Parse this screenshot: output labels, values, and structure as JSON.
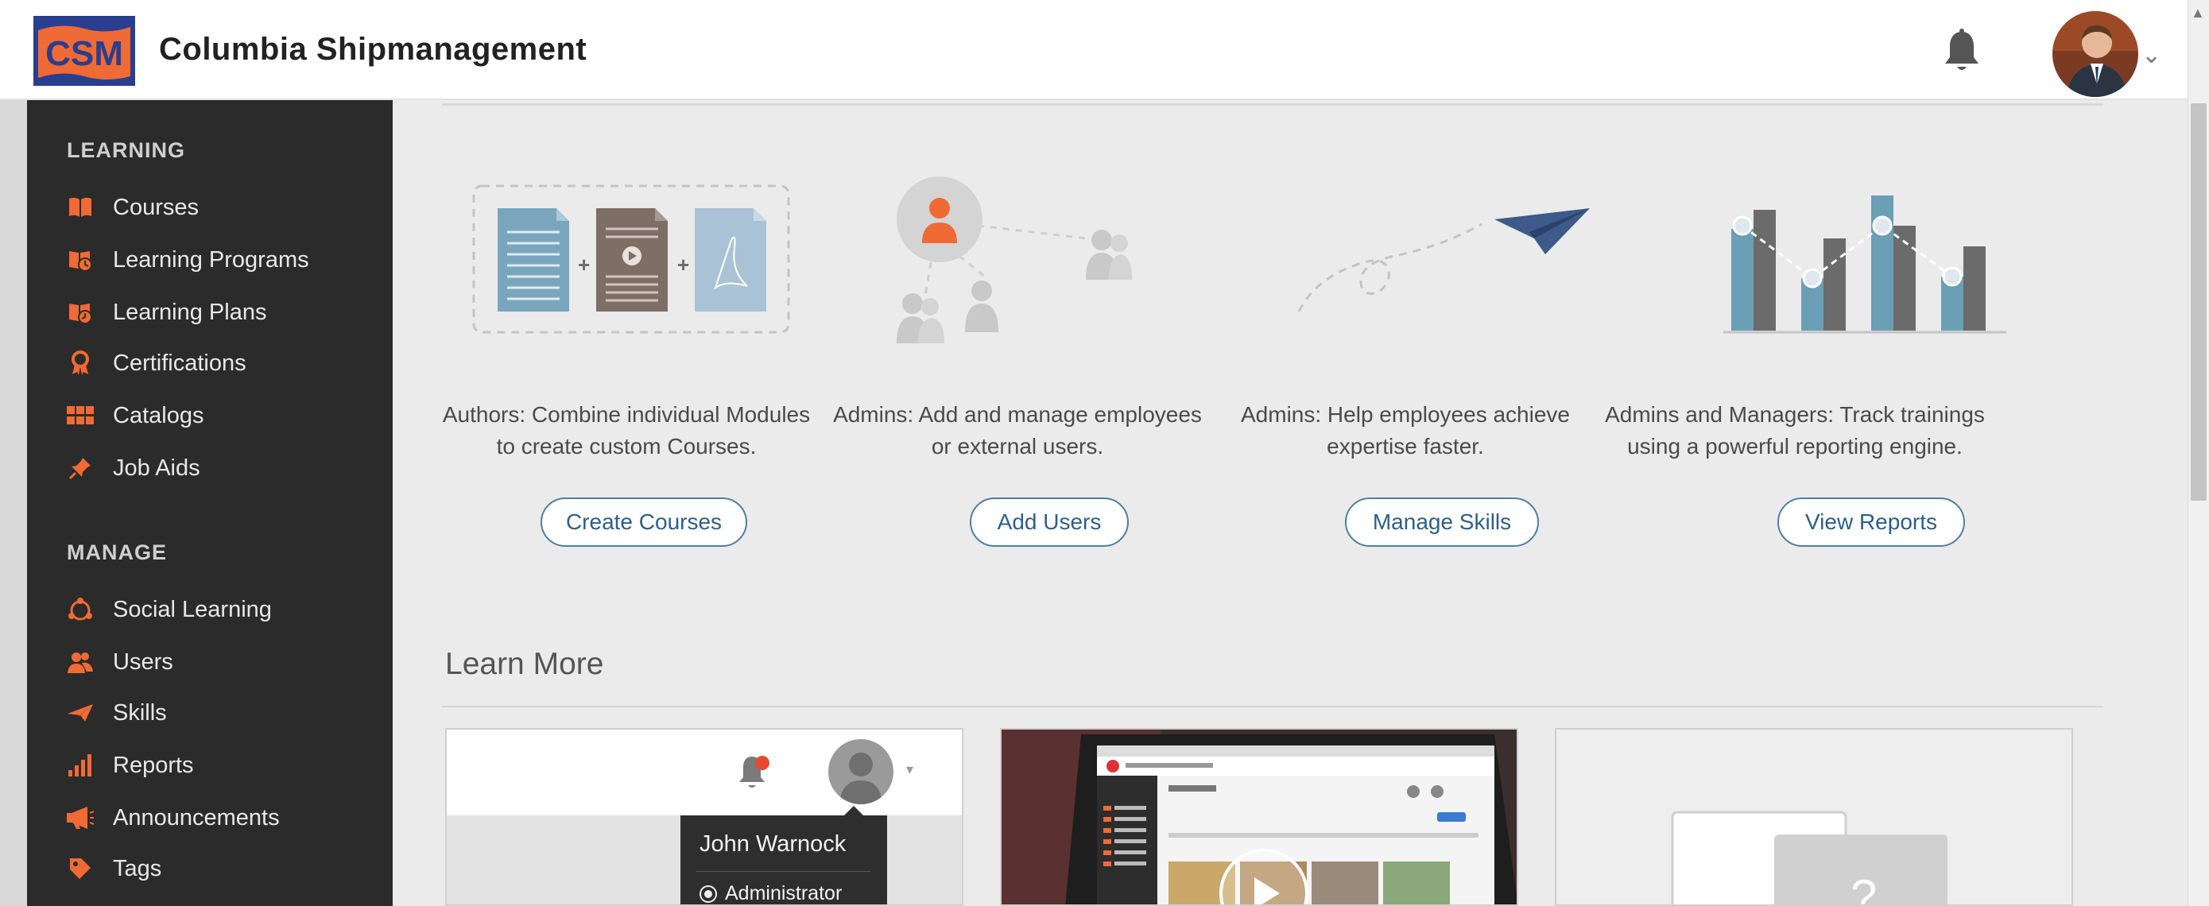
{
  "header": {
    "brand_name": "Columbia Shipmanagement",
    "logo_text": "CSM"
  },
  "sidebar": {
    "sections": [
      {
        "title": "LEARNING",
        "items": [
          {
            "label": "Courses",
            "icon": "book-icon"
          },
          {
            "label": "Learning Programs",
            "icon": "learning-programs-icon"
          },
          {
            "label": "Learning Plans",
            "icon": "learning-plans-icon"
          },
          {
            "label": "Certifications",
            "icon": "certification-ribbon-icon"
          },
          {
            "label": "Catalogs",
            "icon": "catalog-grid-icon"
          },
          {
            "label": "Job Aids",
            "icon": "pushpin-icon"
          }
        ]
      },
      {
        "title": "MANAGE",
        "items": [
          {
            "label": "Social Learning",
            "icon": "social-learning-icon"
          },
          {
            "label": "Users",
            "icon": "users-icon"
          },
          {
            "label": "Skills",
            "icon": "paper-plane-icon"
          },
          {
            "label": "Reports",
            "icon": "bar-chart-icon"
          },
          {
            "label": "Announcements",
            "icon": "megaphone-icon"
          },
          {
            "label": "Tags",
            "icon": "tag-icon"
          }
        ]
      }
    ]
  },
  "feature_cards": [
    {
      "description": "Authors: Combine individual Modules to create custom Courses.",
      "button": "Create Courses"
    },
    {
      "description": "Admins: Add and manage employees or external users.",
      "button": "Add Users"
    },
    {
      "description": "Admins: Help employees achieve expertise faster.",
      "button": "Manage Skills"
    },
    {
      "description": "Admins and Managers: Track trainings using a powerful reporting engine.",
      "button": "View Reports"
    }
  ],
  "learn_more": {
    "title": "Learn More",
    "tile1": {
      "user_name": "John Warnock",
      "role": "Administrator"
    },
    "tile3": {
      "placeholder_glyph": "?"
    }
  },
  "colors": {
    "accent_orange": "#f06a35",
    "sidebar_bg": "#2b2b2b",
    "button_border": "#4f7ea3",
    "chart_teal": "#6a9fb5",
    "chart_gray": "#6b6b6b",
    "plane_blue": "#3d5a8a"
  }
}
